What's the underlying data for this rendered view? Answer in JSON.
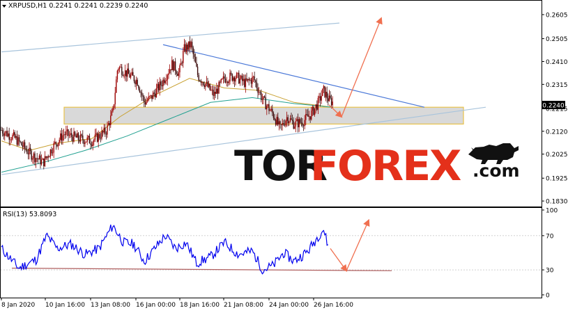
{
  "chart_data": [
    {
      "type": "candlestick",
      "title": "XRPUSD,H1  0.2241 0.2241 0.2239 0.2240",
      "instrument": "XRPUSD",
      "timeframe": "H1",
      "ohlc": {
        "open": 0.2241,
        "high": 0.2241,
        "low": 0.2239,
        "close": 0.224
      },
      "current_price_label": "0.2240",
      "y_ticks": [
        "0.2605",
        "0.2505",
        "0.2410",
        "0.2315",
        "0.2215",
        "0.2120",
        "0.2025",
        "0.1925",
        "0.1830"
      ],
      "ylim": [
        0.181,
        0.266
      ],
      "x_ticks": [
        "8 Jan 2020",
        "10 Jan 16:00",
        "13 Jan 08:00",
        "16 Jan 00:00",
        "18 Jan 16:00",
        "21 Jan 08:00",
        "24 Jan 00:00",
        "26 Jan 16:00"
      ],
      "price_path": [
        {
          "t": 0,
          "v": 0.2125
        },
        {
          "t": 20,
          "v": 0.209
        },
        {
          "t": 40,
          "v": 0.203
        },
        {
          "t": 60,
          "v": 0.199
        },
        {
          "t": 75,
          "v": 0.206
        },
        {
          "t": 90,
          "v": 0.211
        },
        {
          "t": 110,
          "v": 0.209
        },
        {
          "t": 130,
          "v": 0.208
        },
        {
          "t": 150,
          "v": 0.212
        },
        {
          "t": 160,
          "v": 0.22
        },
        {
          "t": 167,
          "v": 0.239
        },
        {
          "t": 180,
          "v": 0.236
        },
        {
          "t": 195,
          "v": 0.233
        },
        {
          "t": 205,
          "v": 0.224
        },
        {
          "t": 215,
          "v": 0.226
        },
        {
          "t": 230,
          "v": 0.232
        },
        {
          "t": 245,
          "v": 0.24
        },
        {
          "t": 255,
          "v": 0.236
        },
        {
          "t": 262,
          "v": 0.246
        },
        {
          "t": 272,
          "v": 0.248
        },
        {
          "t": 282,
          "v": 0.235
        },
        {
          "t": 292,
          "v": 0.232
        },
        {
          "t": 305,
          "v": 0.227
        },
        {
          "t": 320,
          "v": 0.234
        },
        {
          "t": 335,
          "v": 0.235
        },
        {
          "t": 350,
          "v": 0.232
        },
        {
          "t": 362,
          "v": 0.234
        },
        {
          "t": 375,
          "v": 0.225
        },
        {
          "t": 390,
          "v": 0.219
        },
        {
          "t": 400,
          "v": 0.213
        },
        {
          "t": 410,
          "v": 0.218
        },
        {
          "t": 420,
          "v": 0.215
        },
        {
          "t": 432,
          "v": 0.216
        },
        {
          "t": 444,
          "v": 0.219
        },
        {
          "t": 455,
          "v": 0.224
        },
        {
          "t": 462,
          "v": 0.229
        },
        {
          "t": 470,
          "v": 0.225
        },
        {
          "t": 476,
          "v": 0.224
        }
      ],
      "moving_averages": [
        {
          "color": "#c8a030",
          "points": [
            {
              "t": 0,
              "v": 0.208
            },
            {
              "t": 40,
              "v": 0.204
            },
            {
              "t": 80,
              "v": 0.207
            },
            {
              "t": 130,
              "v": 0.209
            },
            {
              "t": 170,
              "v": 0.218
            },
            {
              "t": 220,
              "v": 0.227
            },
            {
              "t": 270,
              "v": 0.234
            },
            {
              "t": 320,
              "v": 0.23
            },
            {
              "t": 370,
              "v": 0.229
            },
            {
              "t": 420,
              "v": 0.224
            },
            {
              "t": 476,
              "v": 0.222
            }
          ]
        },
        {
          "color": "#20a090",
          "points": [
            {
              "t": 0,
              "v": 0.195
            },
            {
              "t": 60,
              "v": 0.199
            },
            {
              "t": 120,
              "v": 0.204
            },
            {
              "t": 180,
              "v": 0.21
            },
            {
              "t": 240,
              "v": 0.217
            },
            {
              "t": 300,
              "v": 0.224
            },
            {
              "t": 360,
              "v": 0.226
            },
            {
              "t": 420,
              "v": 0.2235
            },
            {
              "t": 476,
              "v": 0.222
            }
          ]
        }
      ],
      "trendlines": [
        {
          "color": "#a8c4dc",
          "from": {
            "t": 0,
            "v": 0.245
          },
          "to": {
            "t": 485,
            "v": 0.257
          }
        },
        {
          "color": "#a8c4dc",
          "from": {
            "t": 0,
            "v": 0.194
          },
          "to": {
            "t": 695,
            "v": 0.222
          }
        },
        {
          "color": "#4a78d8",
          "from": {
            "t": 232,
            "v": 0.248
          },
          "to": {
            "t": 607,
            "v": 0.222
          }
        }
      ],
      "zone": {
        "top": 0.222,
        "bottom": 0.215,
        "t_start": 90,
        "t_end": 663
      },
      "forecast_arrows": [
        {
          "from": {
            "t": 470,
            "v": 0.223
          },
          "to": {
            "t": 488,
            "v": 0.218
          }
        },
        {
          "from": {
            "t": 488,
            "v": 0.218
          },
          "to": {
            "t": 545,
            "v": 0.259
          }
        }
      ]
    },
    {
      "type": "line",
      "title": "RSI(13) 53.8093",
      "indicator": "RSI(13)",
      "value": 53.8093,
      "y_ticks": [
        "100",
        "70",
        "30",
        "0"
      ],
      "ylim": [
        0,
        100
      ],
      "rsi_path": [
        {
          "t": 0,
          "v": 55
        },
        {
          "t": 25,
          "v": 32
        },
        {
          "t": 50,
          "v": 42
        },
        {
          "t": 65,
          "v": 70
        },
        {
          "t": 80,
          "v": 55
        },
        {
          "t": 100,
          "v": 60
        },
        {
          "t": 120,
          "v": 48
        },
        {
          "t": 140,
          "v": 55
        },
        {
          "t": 160,
          "v": 82
        },
        {
          "t": 175,
          "v": 62
        },
        {
          "t": 190,
          "v": 60
        },
        {
          "t": 205,
          "v": 40
        },
        {
          "t": 220,
          "v": 55
        },
        {
          "t": 235,
          "v": 70
        },
        {
          "t": 250,
          "v": 55
        },
        {
          "t": 265,
          "v": 62
        },
        {
          "t": 280,
          "v": 38
        },
        {
          "t": 300,
          "v": 45
        },
        {
          "t": 320,
          "v": 62
        },
        {
          "t": 340,
          "v": 48
        },
        {
          "t": 360,
          "v": 52
        },
        {
          "t": 375,
          "v": 30
        },
        {
          "t": 390,
          "v": 35
        },
        {
          "t": 405,
          "v": 50
        },
        {
          "t": 420,
          "v": 40
        },
        {
          "t": 440,
          "v": 52
        },
        {
          "t": 455,
          "v": 70
        },
        {
          "t": 462,
          "v": 78
        },
        {
          "t": 470,
          "v": 54
        }
      ],
      "support_line": {
        "color": "#b06060",
        "from": {
          "t": 15,
          "v": 32
        },
        "to": {
          "t": 560,
          "v": 29
        }
      },
      "forecast_arrows": [
        {
          "from": {
            "t": 472,
            "v": 55
          },
          "to": {
            "t": 495,
            "v": 29
          }
        },
        {
          "from": {
            "t": 495,
            "v": 29
          },
          "to": {
            "t": 527,
            "v": 88
          }
        }
      ]
    }
  ],
  "logo": {
    "part1": "TOR",
    "part2": "FOREX",
    "part3": ".com"
  },
  "colors": {
    "bull_candle": "#9b0000",
    "bear_candle": "#3a0a0a",
    "rsi_line": "#0000ee",
    "forecast_arrow": "#f07050",
    "zone_fill": "#d9d9d9",
    "zone_border": "#e8c24a",
    "logo_dark": "#111111",
    "logo_red": "#e4301a"
  }
}
